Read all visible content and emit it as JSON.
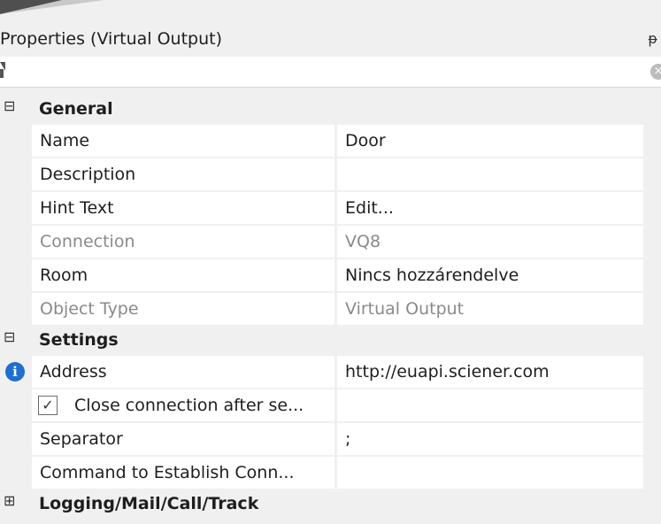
{
  "panel": {
    "title": "Properties (Virtual Output)",
    "pin_icon": "pin-icon",
    "filter_icon": "filter-icon",
    "clear_icon": "clear-icon",
    "clear_glyph": "×"
  },
  "sections": {
    "general": {
      "label": "General",
      "expanded": true,
      "rows": {
        "name": {
          "label": "Name",
          "value": "Door"
        },
        "description": {
          "label": "Description",
          "value": ""
        },
        "hint_text": {
          "label": "Hint Text",
          "value": "Edit..."
        },
        "connection": {
          "label": "Connection",
          "value": "VQ8"
        },
        "room": {
          "label": "Room",
          "value": "Nincs hozzárendelve"
        },
        "object_type": {
          "label": "Object Type",
          "value": "Virtual Output"
        }
      }
    },
    "settings": {
      "label": "Settings",
      "expanded": true,
      "rows": {
        "address": {
          "label": "Address",
          "value": "http://euapi.sciener.com"
        },
        "close_connection": {
          "label": "Close connection after se...",
          "checked": true
        },
        "separator": {
          "label": "Separator",
          "value": ";"
        },
        "command": {
          "label": "Command to Establish Conn...",
          "value": ""
        }
      }
    },
    "logging": {
      "label": "Logging/Mail/Call/Track",
      "expanded": false
    }
  },
  "glyphs": {
    "collapse": "⊟",
    "expand": "⊞",
    "check": "✓",
    "pin": "ᵽ",
    "info": "i"
  },
  "colors": {
    "info_blue": "#1e6fd0",
    "disabled_text": "#8a8a8a"
  }
}
